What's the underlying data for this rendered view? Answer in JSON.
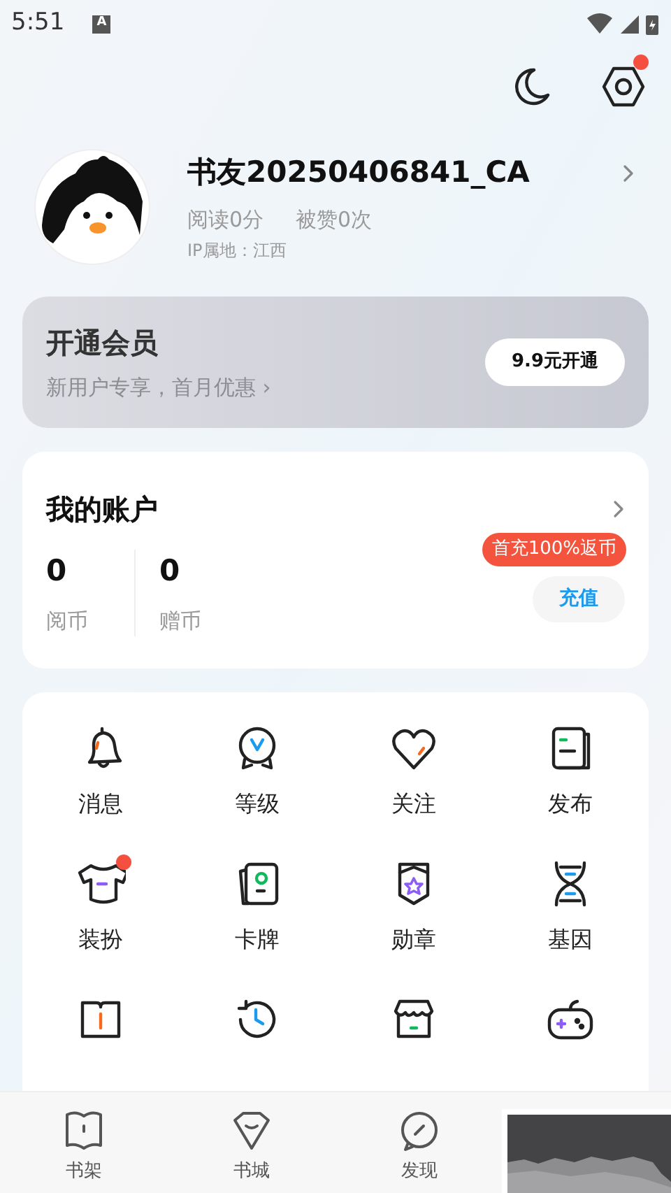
{
  "status_bar": {
    "time": "5:51",
    "badge": "A"
  },
  "top_actions": [
    {
      "kind": "moon",
      "dot": false
    },
    {
      "kind": "settings",
      "dot": true
    }
  ],
  "profile": {
    "name": "书友20250406841_CA",
    "stats": [
      "阅读0分",
      "被赞0次"
    ],
    "ip": "IP属地：江西"
  },
  "membership": {
    "title": "开通会员",
    "subtitle": "新用户专享，首月优惠 ›",
    "button": "9.9元开通"
  },
  "account": {
    "title": "我的账户",
    "balances": [
      {
        "value": "0",
        "label": "阅币"
      },
      {
        "value": "0",
        "label": "赠币"
      }
    ],
    "promo": "首充100%返币",
    "button": "充值"
  },
  "features": [
    {
      "kind": "bell",
      "label": "消息",
      "dot": false
    },
    {
      "kind": "level",
      "label": "等级",
      "dot": false
    },
    {
      "kind": "heart",
      "label": "关注",
      "dot": false
    },
    {
      "kind": "publish",
      "label": "发布",
      "dot": false
    },
    {
      "kind": "shirt",
      "label": "装扮",
      "dot": true
    },
    {
      "kind": "cards",
      "label": "卡牌",
      "dot": false
    },
    {
      "kind": "medal",
      "label": "勋章",
      "dot": false
    },
    {
      "kind": "dna",
      "label": "基因",
      "dot": false
    },
    {
      "kind": "book",
      "dot": false
    },
    {
      "kind": "history",
      "dot": false
    },
    {
      "kind": "shop",
      "dot": false
    },
    {
      "kind": "game",
      "dot": false
    }
  ],
  "bottom_nav": [
    {
      "kind": "shelf",
      "label": "书架"
    },
    {
      "kind": "store",
      "label": "书城"
    },
    {
      "kind": "discover",
      "label": "发现"
    }
  ]
}
